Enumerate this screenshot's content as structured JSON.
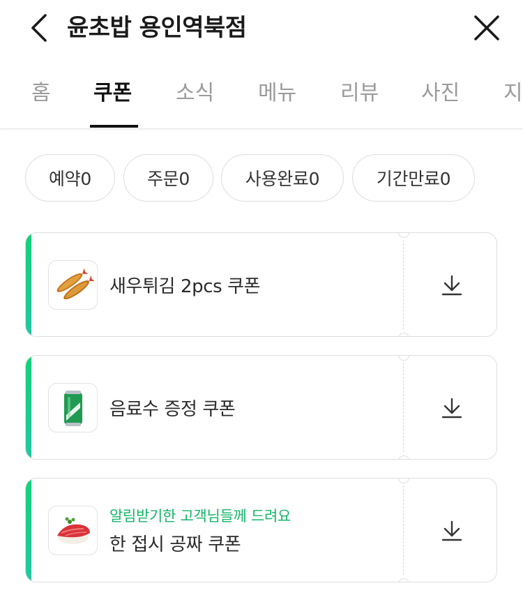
{
  "header": {
    "title": "윤초밥 용인역북점",
    "back_icon": "chevron-left-icon",
    "close_icon": "close-icon"
  },
  "tabs": [
    {
      "label": "홈",
      "active": false
    },
    {
      "label": "쿠폰",
      "active": true
    },
    {
      "label": "소식",
      "active": false
    },
    {
      "label": "메뉴",
      "active": false
    },
    {
      "label": "리뷰",
      "active": false
    },
    {
      "label": "사진",
      "active": false
    },
    {
      "label": "지",
      "active": false
    }
  ],
  "filters": [
    {
      "label": "예약0"
    },
    {
      "label": "주문0"
    },
    {
      "label": "사용완료0"
    },
    {
      "label": "기간만료0"
    }
  ],
  "coupons": [
    {
      "name": "새우튀김 2pcs 쿠폰",
      "subtitle": "",
      "image": "fried-shrimp-icon"
    },
    {
      "name": "음료수 증정 쿠폰",
      "subtitle": "",
      "image": "soda-can-icon"
    },
    {
      "name": "한 접시 공짜 쿠폰",
      "subtitle": "알림받기한 고객님들께 드려요",
      "image": "tuna-sushi-icon"
    }
  ],
  "colors": {
    "accent": "#12d27a",
    "subtitle_green": "#14b566",
    "inactive_tab": "#9a9a9a"
  }
}
